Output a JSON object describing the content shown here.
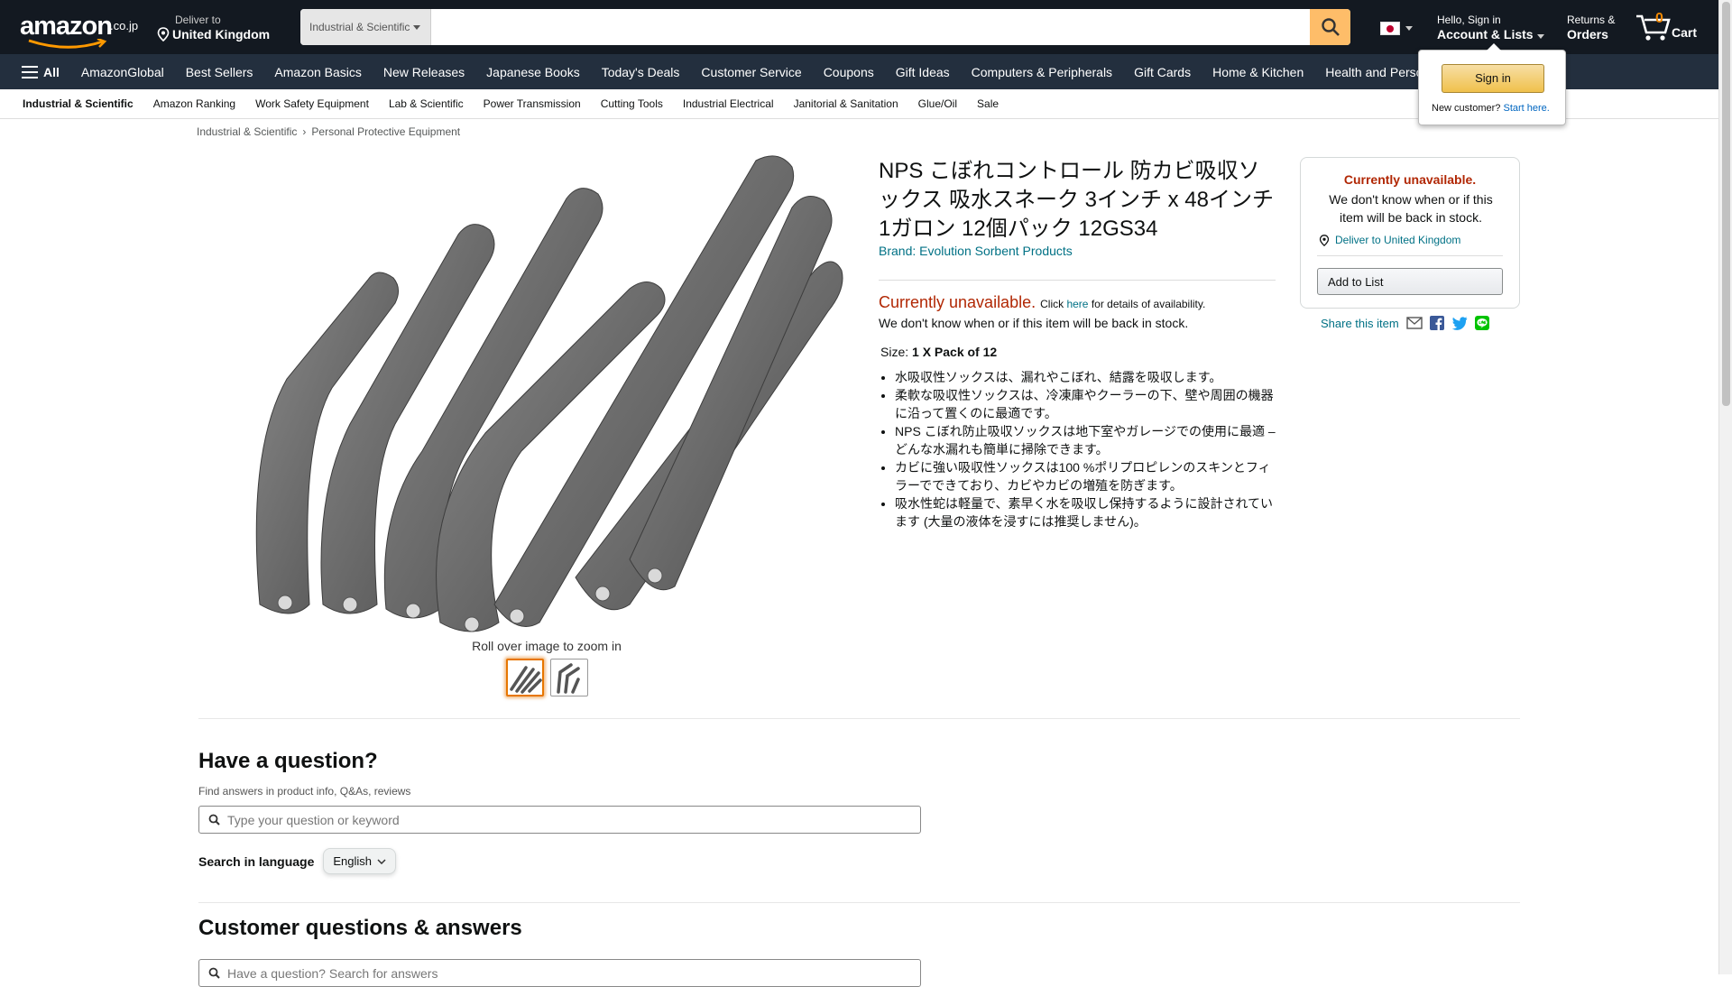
{
  "header": {
    "logo_text": "amazon",
    "logo_tld": ".co.jp",
    "deliver_line1": "Deliver to",
    "deliver_line2": "United Kingdom",
    "search_category": "Industrial & Scientific",
    "search_placeholder": "",
    "account_line1": "Hello, Sign in",
    "account_line2": "Account & Lists",
    "orders_line1": "Returns &",
    "orders_line2": "Orders",
    "cart_count": "0",
    "cart_label": "Cart"
  },
  "nav_main": {
    "all_label": "All",
    "items": [
      "AmazonGlobal",
      "Best Sellers",
      "Amazon Basics",
      "New Releases",
      "Japanese Books",
      "Today's Deals",
      "Customer Service",
      "Coupons",
      "Gift Ideas",
      "Computers & Peripherals",
      "Gift Cards",
      "Home & Kitchen",
      "Health and Perso"
    ]
  },
  "nav_sub": {
    "items": [
      "Industrial & Scientific",
      "Amazon Ranking",
      "Work Safety Equipment",
      "Lab & Scientific",
      "Power Transmission",
      "Cutting Tools",
      "Industrial Electrical",
      "Janitorial & Sanitation",
      "Glue/Oil",
      "Sale"
    ]
  },
  "signin_popover": {
    "button": "Sign in",
    "new_customer": "New customer?",
    "start_here": "Start here."
  },
  "breadcrumb": [
    "Industrial & Scientific",
    "Personal Protective Equipment"
  ],
  "product": {
    "title": "NPS こぼれコントロール 防カビ吸収ソックス 吸水スネーク 3インチ x 48インチ 1ガロン 12個パック 12GS34",
    "brand": "Brand: Evolution Sorbent Products",
    "unavailable": "Currently unavailable.",
    "click": "Click",
    "here": "here",
    "details": "for details of availability.",
    "back_in_stock": "We don't know when or if this item will be back in stock.",
    "size_label": "Size:",
    "size_value": "1 X Pack of 12",
    "bullets": [
      "水吸収性ソックスは、漏れやこぼれ、結露を吸収します。",
      "柔軟な吸収性ソックスは、冷凍庫やクーラーの下、壁や周囲の機器に沿って置くのに最適です。",
      "NPS こぼれ防止吸収ソックスは地下室やガレージでの使用に最適 – どんな水漏れも簡単に掃除できます。",
      "カビに強い吸収性ソックスは100 %ポリプロピレンのスキンとフィラーでできており、カビやカビの増殖を防ぎます。",
      "吸水性蛇は軽量で、素早く水を吸収し保持するように設計されています (大量の液体を浸すには推奨しません)。"
    ],
    "zoom_hint": "Roll over image to zoom in"
  },
  "buybox": {
    "unavailable": "Currently unavailable.",
    "message": "We don't know when or if this item will be back in stock.",
    "deliver": "Deliver to United Kingdom",
    "add_to_list": "Add to List",
    "share": "Share this item"
  },
  "questions": {
    "title": "Have a question?",
    "subtitle": "Find answers in product info, Q&As, reviews",
    "placeholder": "Type your question or keyword",
    "lang_label": "Search in language",
    "lang_value": "English",
    "qa_title": "Customer questions & answers",
    "qa_placeholder": "Have a question? Search for answers"
  },
  "colors": {
    "nav_dark": "#131921",
    "nav_main": "#232f3e",
    "search_button": "#febd69",
    "link": "#007185",
    "unavailable": "#b12704",
    "cart_count": "#f08804"
  }
}
